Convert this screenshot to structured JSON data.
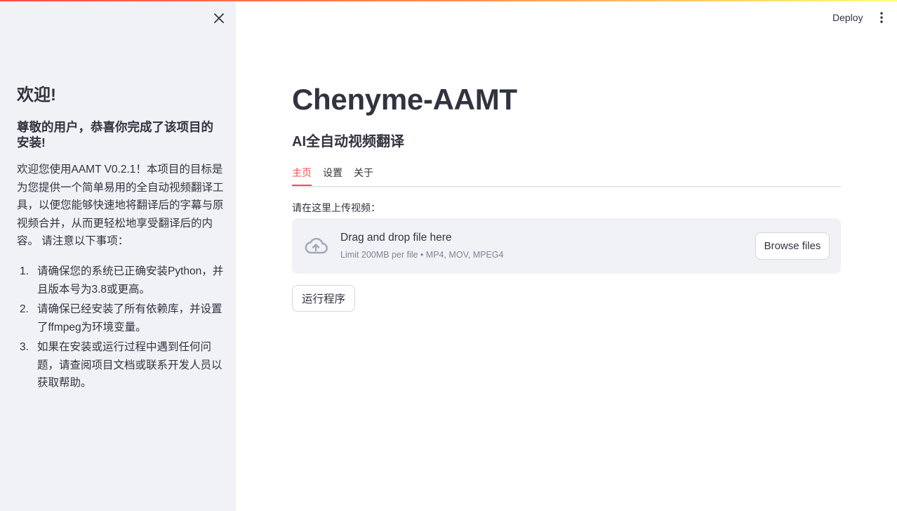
{
  "header": {
    "deploy_label": "Deploy",
    "menu_icon": "kebab-menu-icon"
  },
  "colors": {
    "accent": "#ff4b4b",
    "sidebar_bg": "#f0f2f6",
    "text": "#31333f",
    "muted": "#808495"
  },
  "sidebar": {
    "close_icon": "close-icon",
    "title": "欢迎!",
    "subtitle": "尊敬的用户，恭喜你完成了该项目的安装!",
    "paragraph": "欢迎您使用AAMT V0.2.1！本项目的目标是为您提供一个简单易用的全自动视频翻译工具，以便您能够快速地将翻译后的字幕与原视频合并，从而更轻松地享受翻译后的内容。 请注意以下事项：",
    "notes": [
      {
        "num": "1.",
        "text": "请确保您的系统已正确安装Python，并且版本号为3.8或更高。"
      },
      {
        "num": "2.",
        "text": "请确保已经安装了所有依赖库，并设置了ffmpeg为环境变量。"
      },
      {
        "num": "3.",
        "text": "如果在安装或运行过程中遇到任何问题，请查阅项目文档或联系开发人员以获取帮助。"
      }
    ]
  },
  "main": {
    "title": "Chenyme-AAMT",
    "subtitle": "AI全自动视频翻译",
    "tabs": [
      {
        "label": "主页",
        "active": true
      },
      {
        "label": "设置",
        "active": false
      },
      {
        "label": "关于",
        "active": false
      }
    ],
    "upload": {
      "label": "请在这里上传视频：",
      "icon": "cloud-upload-icon",
      "drop_text": "Drag and drop file here",
      "limit_text": "Limit 200MB per file • MP4, MOV, MPEG4",
      "browse_label": "Browse files"
    },
    "run_button_label": "运行程序"
  }
}
